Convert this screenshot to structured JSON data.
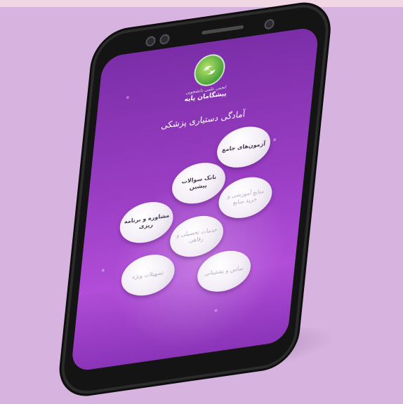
{
  "app": {
    "brand_subtitle": "انجمن علمی دانشجویی",
    "brand_name": "پیشگامان پایه",
    "heading": "آمادگی دستیاری پزشکی"
  },
  "menu": [
    {
      "label": "آزمون‌های جامع",
      "state": "active"
    },
    {
      "label": "بانک سوالات پیشین",
      "state": "active"
    },
    {
      "label": "مشاوره و برنامه ریزی",
      "state": "active"
    },
    {
      "label": "منابع آموزشی و خرید منابع",
      "state": "faded"
    },
    {
      "label": "خدمات تحصیلی و رفاهی",
      "state": "faded"
    },
    {
      "label": "تسهیلات ویژه",
      "state": "faded"
    },
    {
      "label": "تماس و پشتیبانی",
      "state": "faded"
    }
  ],
  "colors": {
    "background": "#d7b3df",
    "screen_top": "#7b2ea8",
    "screen_bottom": "#b14dd8",
    "logo_green": "#4aa23a"
  }
}
